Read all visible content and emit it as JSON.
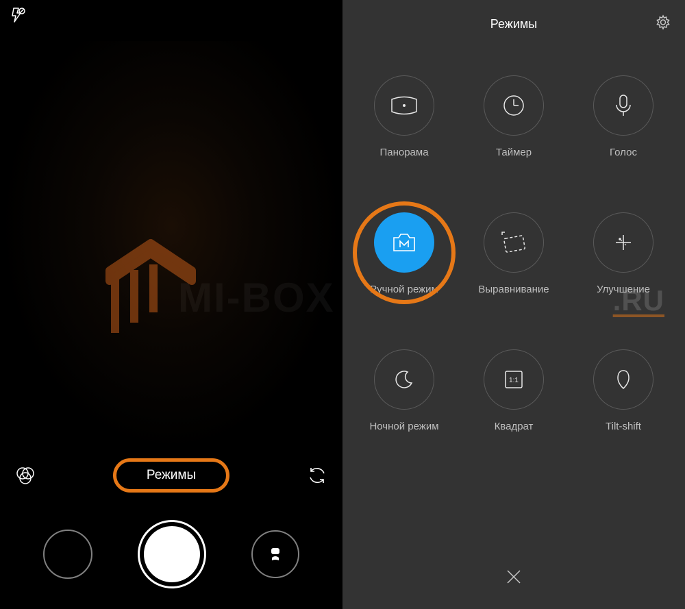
{
  "left": {
    "flash_label": "ᶾ⌀",
    "modes_label": "Режимы",
    "watermark_text": "MI-BOX"
  },
  "right": {
    "title": "Режимы",
    "watermark_text": ".RU",
    "modes": {
      "panorama": "Панорама",
      "timer": "Таймер",
      "voice": "Голос",
      "manual": "Ручной режим",
      "straighten": "Выравнивание",
      "beautify": "Улучшение",
      "night": "Ночной режим",
      "square": "Квадрат",
      "tiltshift": "Tilt-shift"
    },
    "square_badge": "1:1"
  }
}
